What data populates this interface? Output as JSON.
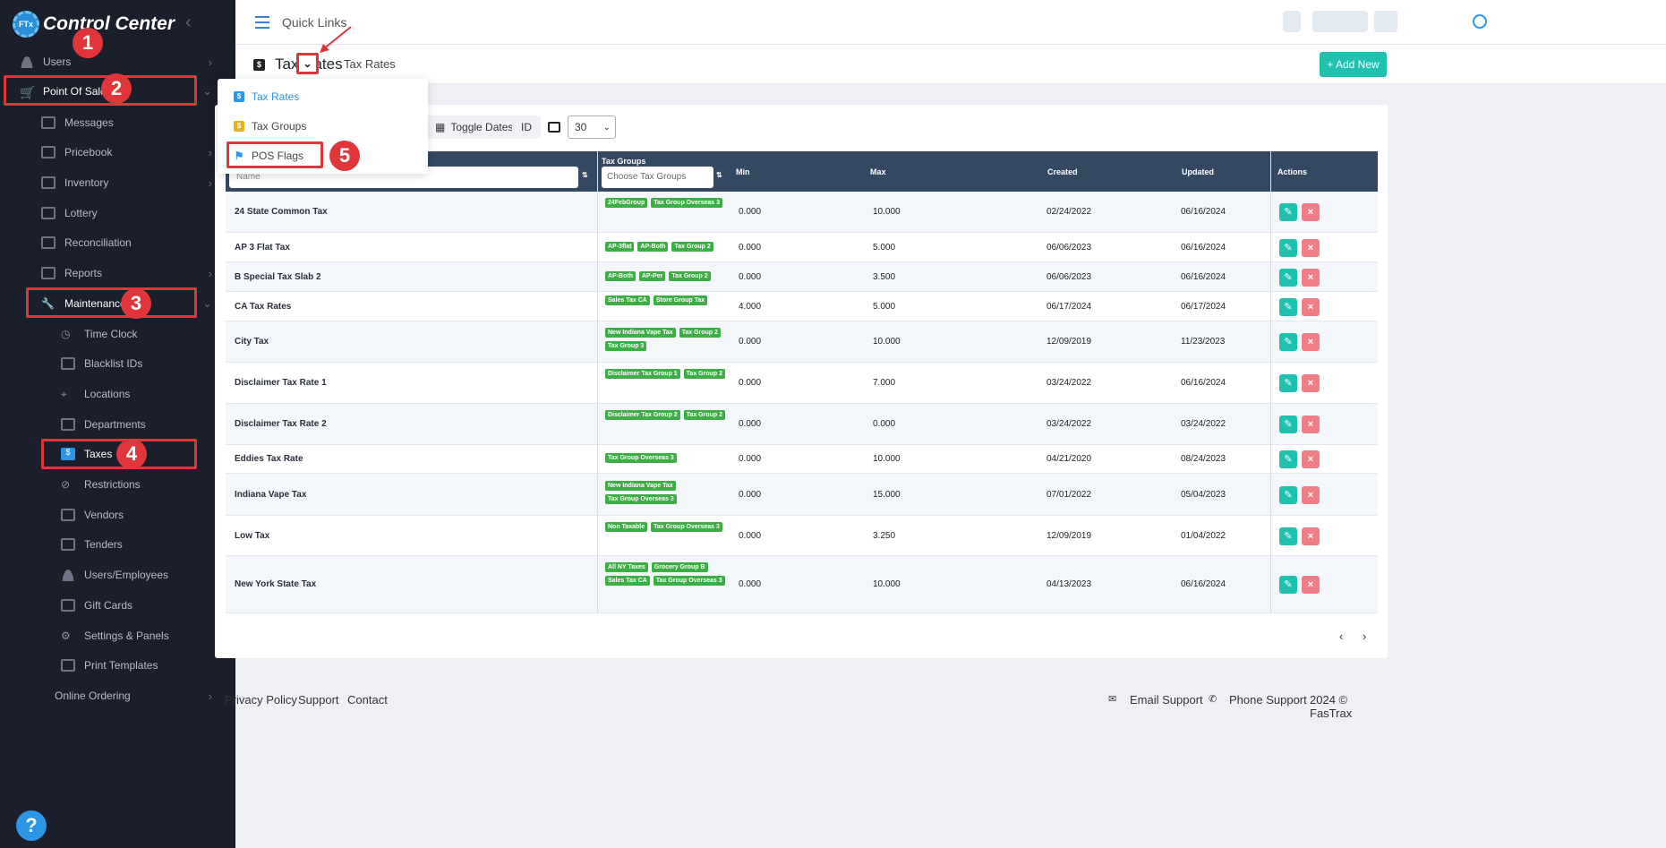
{
  "app": {
    "title": "Control Center",
    "logo_text": "FTx"
  },
  "sidebar": {
    "items": [
      {
        "label": "Users"
      },
      {
        "label": "Point Of Sale"
      },
      {
        "label": "Messages"
      },
      {
        "label": "Pricebook"
      },
      {
        "label": "Inventory"
      },
      {
        "label": "Lottery"
      },
      {
        "label": "Reconciliation"
      },
      {
        "label": "Reports"
      },
      {
        "label": "Maintenance"
      },
      {
        "label": "Time Clock"
      },
      {
        "label": "Blacklist IDs"
      },
      {
        "label": "Locations"
      },
      {
        "label": "Departments"
      },
      {
        "label": "Taxes"
      },
      {
        "label": "Restrictions"
      },
      {
        "label": "Vendors"
      },
      {
        "label": "Tenders"
      },
      {
        "label": "Users/Employees"
      },
      {
        "label": "Gift Cards"
      },
      {
        "label": "Settings & Panels"
      },
      {
        "label": "Print Templates"
      },
      {
        "label": "Online Ordering"
      }
    ],
    "help": "?"
  },
  "annotations": [
    "1",
    "2",
    "3",
    "4",
    "5"
  ],
  "header": {
    "quick_links": "Quick Links"
  },
  "page": {
    "icon": "$",
    "title": "Tax Rates",
    "breadcrumb": "Tax Rates",
    "add_button": "+ Add New"
  },
  "dropdown": {
    "items": [
      {
        "label": "Tax Rates",
        "icon": "$"
      },
      {
        "label": "Tax Groups",
        "icon": "$"
      },
      {
        "label": "POS Flags",
        "icon": "flag-icon"
      }
    ]
  },
  "toolbar": {
    "toggle_dates": "Toggle Dates",
    "id": "ID",
    "per_page": "30"
  },
  "table": {
    "headers": {
      "tax_groups": "Tax Groups",
      "min": "Min",
      "max": "Max",
      "created": "Created",
      "updated": "Updated",
      "actions": "Actions"
    },
    "name_placeholder": "Name",
    "tax_groups_placeholder": "Choose Tax Groups",
    "rows": [
      {
        "name": "24 State Common Tax",
        "groups": [
          "24FebGroup",
          "Tax Group Overseas 3"
        ],
        "min": "0.000",
        "max": "10.000",
        "created": "02/24/2022",
        "updated": "06/16/2024"
      },
      {
        "name": "AP 3 Flat Tax",
        "groups": [
          "AP-3flat",
          "AP-Both",
          "Tax Group 2"
        ],
        "min": "0.000",
        "max": "5.000",
        "created": "06/06/2023",
        "updated": "06/16/2024"
      },
      {
        "name": "B Special Tax Slab 2",
        "groups": [
          "AP-Both",
          "AP-Per",
          "Tax Group 2"
        ],
        "min": "0.000",
        "max": "3.500",
        "created": "06/06/2023",
        "updated": "06/16/2024"
      },
      {
        "name": "CA Tax Rates",
        "groups": [
          "Sales Tax CA",
          "Store Group Tax"
        ],
        "min": "4.000",
        "max": "5.000",
        "created": "06/17/2024",
        "updated": "06/17/2024"
      },
      {
        "name": "City Tax",
        "groups": [
          "New Indiana Vape Tax",
          "Tax Group 2",
          "Tax Group 3"
        ],
        "min": "0.000",
        "max": "10.000",
        "created": "12/09/2019",
        "updated": "11/23/2023"
      },
      {
        "name": "Disclaimer Tax Rate 1",
        "groups": [
          "Disclaimer Tax Group 1",
          "Tax Group 2"
        ],
        "min": "0.000",
        "max": "7.000",
        "created": "03/24/2022",
        "updated": "06/16/2024"
      },
      {
        "name": "Disclaimer Tax Rate 2",
        "groups": [
          "Disclaimer Tax Group 2",
          "Tax Group 2"
        ],
        "min": "0.000",
        "max": "0.000",
        "created": "03/24/2022",
        "updated": "03/24/2022"
      },
      {
        "name": "Eddies Tax Rate",
        "groups": [
          "Tax Group Overseas 3"
        ],
        "min": "0.000",
        "max": "10.000",
        "created": "04/21/2020",
        "updated": "08/24/2023"
      },
      {
        "name": "Indiana Vape Tax",
        "groups": [
          "New Indiana Vape Tax",
          "Tax Group Overseas 3"
        ],
        "min": "0.000",
        "max": "15.000",
        "created": "07/01/2022",
        "updated": "05/04/2023"
      },
      {
        "name": "Low Tax",
        "groups": [
          "Non Taxable",
          "Tax Group Overseas 3"
        ],
        "min": "0.000",
        "max": "3.250",
        "created": "12/09/2019",
        "updated": "01/04/2022"
      },
      {
        "name": "New York State Tax",
        "groups": [
          "All NY Taxes",
          "Grocery Group B",
          "Sales Tax CA",
          "Tax Group Overseas 3"
        ],
        "min": "0.000",
        "max": "10.000",
        "created": "04/13/2023",
        "updated": "06/16/2024"
      }
    ]
  },
  "pagination": {
    "prev": "‹",
    "next": "›"
  },
  "footer": {
    "privacy": "Privacy Policy",
    "support": "Support",
    "contact": "Contact",
    "email_support": "Email Support",
    "phone_support": "Phone Support",
    "copyright": "2024 © FasTrax"
  },
  "colors": {
    "sidebar": "#1b1e2b",
    "accent": "#21c1b0",
    "annotation": "#e0363b",
    "table_header": "#344862",
    "tag": "#3dae46"
  }
}
